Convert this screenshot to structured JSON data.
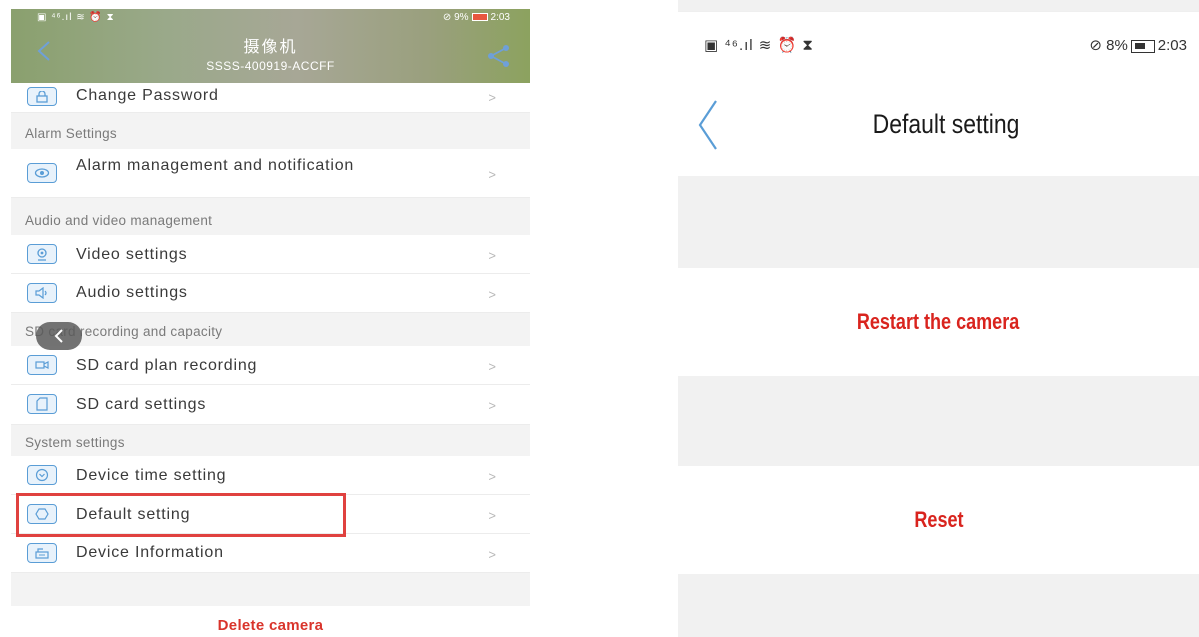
{
  "left_screen": {
    "status_bar": {
      "left": "▣ ⁴⁶.ıl ≋ ⏰ ⧗",
      "battery_pct": "9%",
      "time": "2:03"
    },
    "header": {
      "title": "摄像机",
      "subtitle": "SSSS-400919-ACCFF"
    },
    "items": [
      {
        "id": "change-password",
        "label": "Change Password"
      },
      {
        "id": "alarm-management",
        "label": "Alarm management and notification"
      },
      {
        "id": "video-settings",
        "label": "Video settings"
      },
      {
        "id": "audio-settings",
        "label": "Audio settings"
      },
      {
        "id": "sd-card-plan-recording",
        "label": "SD card plan recording"
      },
      {
        "id": "sd-card-settings",
        "label": "SD card settings"
      },
      {
        "id": "device-time-setting",
        "label": "Device time setting"
      },
      {
        "id": "default-setting",
        "label": "Default setting"
      },
      {
        "id": "device-information",
        "label": "Device Information"
      }
    ],
    "sections": {
      "alarm": "Alarm Settings",
      "audio_video": "Audio and video management",
      "sd_card": "SD card recording and capacity",
      "system": "System settings"
    },
    "chevron": ">",
    "delete_label": "Delete camera"
  },
  "right_screen": {
    "status_bar": {
      "left": "▣ ⁴⁶.ıl ≋ ⏰ ⧗",
      "battery_pct": "8%",
      "time": "2:03"
    },
    "title": "Default setting",
    "restart_label": "Restart the camera",
    "reset_label": "Reset"
  },
  "colors": {
    "accent_red": "#d9241e",
    "icon_blue": "#5a9dd6",
    "highlight_red": "#e0413f"
  }
}
